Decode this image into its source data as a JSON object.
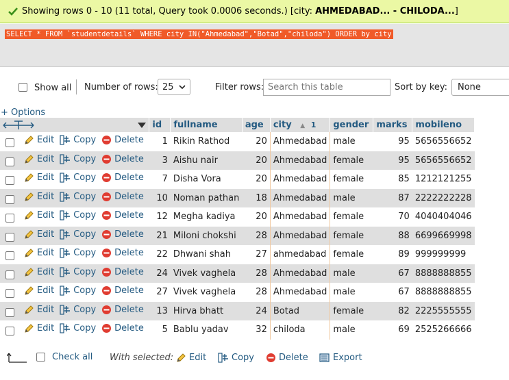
{
  "message": {
    "prefix": "Showing rows 0 - 10 (11 total, Query took 0.0006 seconds.) [city: ",
    "bold": "AHMEDABAD... - CHILODA...",
    "suffix": "]"
  },
  "sql": "SELECT * FROM `studentdetails` WHERE city IN(\"Ahmedabad\",\"Botad\",\"chiloda\") ORDER by city",
  "nav": {
    "show_all": "Show all",
    "number_of_rows_label": "Number of rows:",
    "rows_value": "25",
    "filter_label": "Filter rows:",
    "filter_placeholder": "Search this table",
    "sort_label": "Sort by key:",
    "sort_value": "None"
  },
  "options_link": "+ Options",
  "columns": [
    "id",
    "fullname",
    "age",
    "city",
    "gender",
    "marks",
    "mobileno"
  ],
  "sort_indicator": "1",
  "actions": {
    "edit": "Edit",
    "copy": "Copy",
    "delete": "Delete"
  },
  "rows": [
    {
      "id": "1",
      "fullname": "Rikin Rathod",
      "age": "20",
      "city": "Ahmedabad",
      "gender": "male",
      "marks": "95",
      "mobileno": "5656556652"
    },
    {
      "id": "3",
      "fullname": "Aishu nair",
      "age": "20",
      "city": "Ahmedabad",
      "gender": "female",
      "marks": "95",
      "mobileno": "5656556652"
    },
    {
      "id": "7",
      "fullname": "Disha Vora",
      "age": "20",
      "city": "Ahmedabad",
      "gender": "female",
      "marks": "85",
      "mobileno": "1212121255"
    },
    {
      "id": "10",
      "fullname": "Noman pathan",
      "age": "18",
      "city": "Ahmedabad",
      "gender": "male",
      "marks": "87",
      "mobileno": "2222222228"
    },
    {
      "id": "12",
      "fullname": "Megha kadiya",
      "age": "20",
      "city": "Ahmedabad",
      "gender": "female",
      "marks": "70",
      "mobileno": "4040404046"
    },
    {
      "id": "21",
      "fullname": "Miloni chokshi",
      "age": "28",
      "city": "Ahmedabad",
      "gender": "female",
      "marks": "88",
      "mobileno": "6699669998"
    },
    {
      "id": "22",
      "fullname": "Dhwani shah",
      "age": "27",
      "city": "ahmedabad",
      "gender": "female",
      "marks": "89",
      "mobileno": "999999999"
    },
    {
      "id": "24",
      "fullname": "Vivek vaghela",
      "age": "28",
      "city": "Ahmedabad",
      "gender": "male",
      "marks": "67",
      "mobileno": "8888888855"
    },
    {
      "id": "27",
      "fullname": "Vivek vaghela",
      "age": "28",
      "city": "Ahmedabad",
      "gender": "male",
      "marks": "67",
      "mobileno": "8888888855"
    },
    {
      "id": "13",
      "fullname": "Hirva bhatt",
      "age": "24",
      "city": "Botad",
      "gender": "female",
      "marks": "82",
      "mobileno": "2225555555"
    },
    {
      "id": "5",
      "fullname": "Bablu yadav",
      "age": "32",
      "city": "chiloda",
      "gender": "male",
      "marks": "69",
      "mobileno": "2525266666"
    }
  ],
  "bottom": {
    "check_all": "Check all",
    "with_selected": "With selected:",
    "edit": "Edit",
    "copy": "Copy",
    "delete": "Delete",
    "export": "Export"
  }
}
